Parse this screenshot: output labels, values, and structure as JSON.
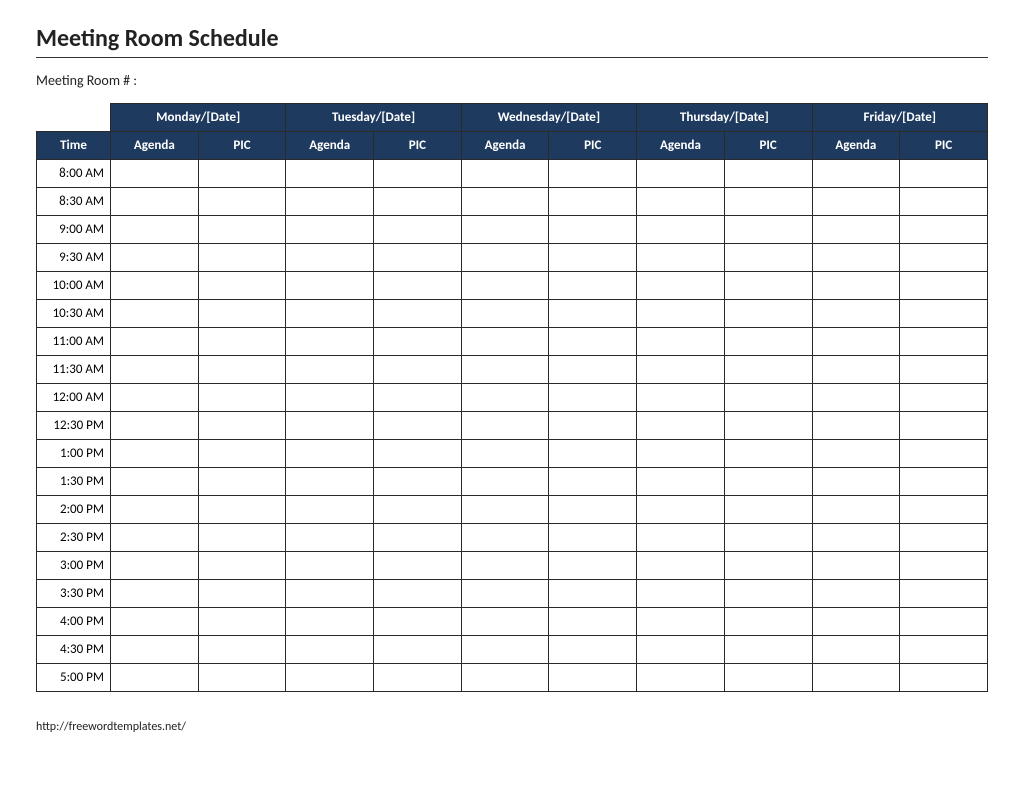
{
  "title": "Meeting Room Schedule",
  "room_label": "Meeting Room # :",
  "columns": {
    "time_header": "Time",
    "days": [
      "Monday/[Date]",
      "Tuesday/[Date]",
      "Wednesday/[Date]",
      "Thursday/[Date]",
      "Friday/[Date]"
    ],
    "subheaders": [
      "Agenda",
      "PIC"
    ]
  },
  "times": [
    "8:00 AM",
    "8:30 AM",
    "9:00 AM",
    "9:30 AM",
    "10:00 AM",
    "10:30 AM",
    "11:00 AM",
    "11:30 AM",
    "12:00 AM",
    "12:30 PM",
    "1:00 PM",
    "1:30 PM",
    "2:00 PM",
    "2:30 PM",
    "3:00 PM",
    "3:30 PM",
    "4:00 PM",
    "4:30 PM",
    "5:00 PM"
  ],
  "footer": "http://freewordtemplates.net/"
}
